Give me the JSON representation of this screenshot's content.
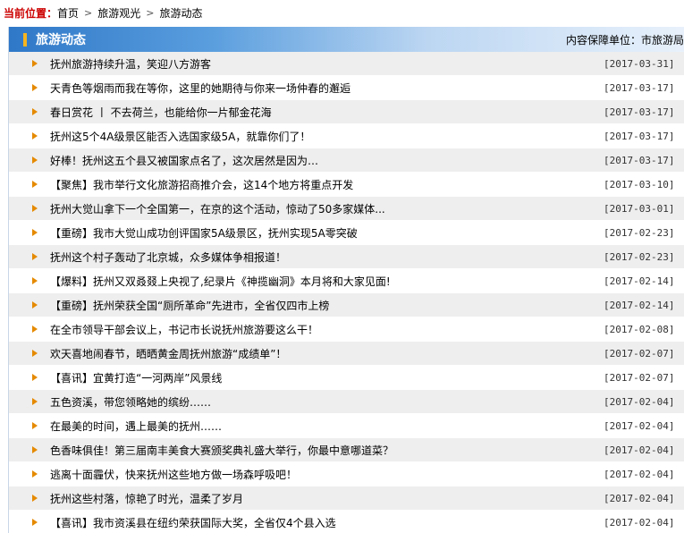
{
  "breadcrumb": {
    "prefix": "当前位置：",
    "items": [
      "首页",
      "旅游观光",
      "旅游动态"
    ]
  },
  "panel": {
    "title": "旅游动态",
    "unit": "内容保障单位：市旅游局"
  },
  "news": [
    {
      "title": "抚州旅游持续升温，笑迎八方游客",
      "date": "[2017-03-31]"
    },
    {
      "title": "天青色等烟雨而我在等你，这里的她期待与你来一场仲春的邂逅",
      "date": "[2017-03-17]"
    },
    {
      "title": "春日赏花 丨 不去荷兰，也能给你一片郁金花海",
      "date": "[2017-03-17]"
    },
    {
      "title": "抚州这5个4A级景区能否入选国家级5A，就靠你们了！",
      "date": "[2017-03-17]"
    },
    {
      "title": "好棒！抚州这五个县又被国家点名了，这次居然是因为…",
      "date": "[2017-03-17]"
    },
    {
      "title": "【聚焦】我市举行文化旅游招商推介会，这14个地方将重点开发",
      "date": "[2017-03-10]"
    },
    {
      "title": "抚州大觉山拿下一个全国第一，在京的这个活动，惊动了50多家媒体...",
      "date": "[2017-03-01]"
    },
    {
      "title": "【重磅】我市大觉山成功创评国家5A级景区，抚州实现5A零突破",
      "date": "[2017-02-23]"
    },
    {
      "title": "抚州这个村子轰动了北京城，众多媒体争相报道！",
      "date": "[2017-02-23]"
    },
    {
      "title": "【爆料】抚州又双叒叕上央视了,纪录片《神揽幽洞》本月将和大家见面!",
      "date": "[2017-02-14]"
    },
    {
      "title": "【重磅】抚州荣获全国“厕所革命”先进市，全省仅四市上榜",
      "date": "[2017-02-14]"
    },
    {
      "title": "在全市领导干部会议上，书记市长说抚州旅游要这么干！",
      "date": "[2017-02-08]"
    },
    {
      "title": "欢天喜地闹春节，晒晒黄金周抚州旅游“成绩单”！",
      "date": "[2017-02-07]"
    },
    {
      "title": "【喜讯】宜黄打造“一河两岸”风景线",
      "date": "[2017-02-07]"
    },
    {
      "title": "五色资溪，带您领略她的缤纷……",
      "date": "[2017-02-04]"
    },
    {
      "title": "在最美的时间，遇上最美的抚州……",
      "date": "[2017-02-04]"
    },
    {
      "title": "色香味俱佳！第三届南丰美食大赛颁奖典礼盛大举行，你最中意哪道菜？",
      "date": "[2017-02-04]"
    },
    {
      "title": "逃离十面霾伏，快来抚州这些地方做一场森呼吸吧！",
      "date": "[2017-02-04]"
    },
    {
      "title": "抚州这些村落，惊艳了时光，温柔了岁月",
      "date": "[2017-02-04]"
    },
    {
      "title": "【喜讯】我市资溪县在纽约荣获国际大奖，全省仅4个县入选",
      "date": "[2017-02-04]"
    }
  ]
}
